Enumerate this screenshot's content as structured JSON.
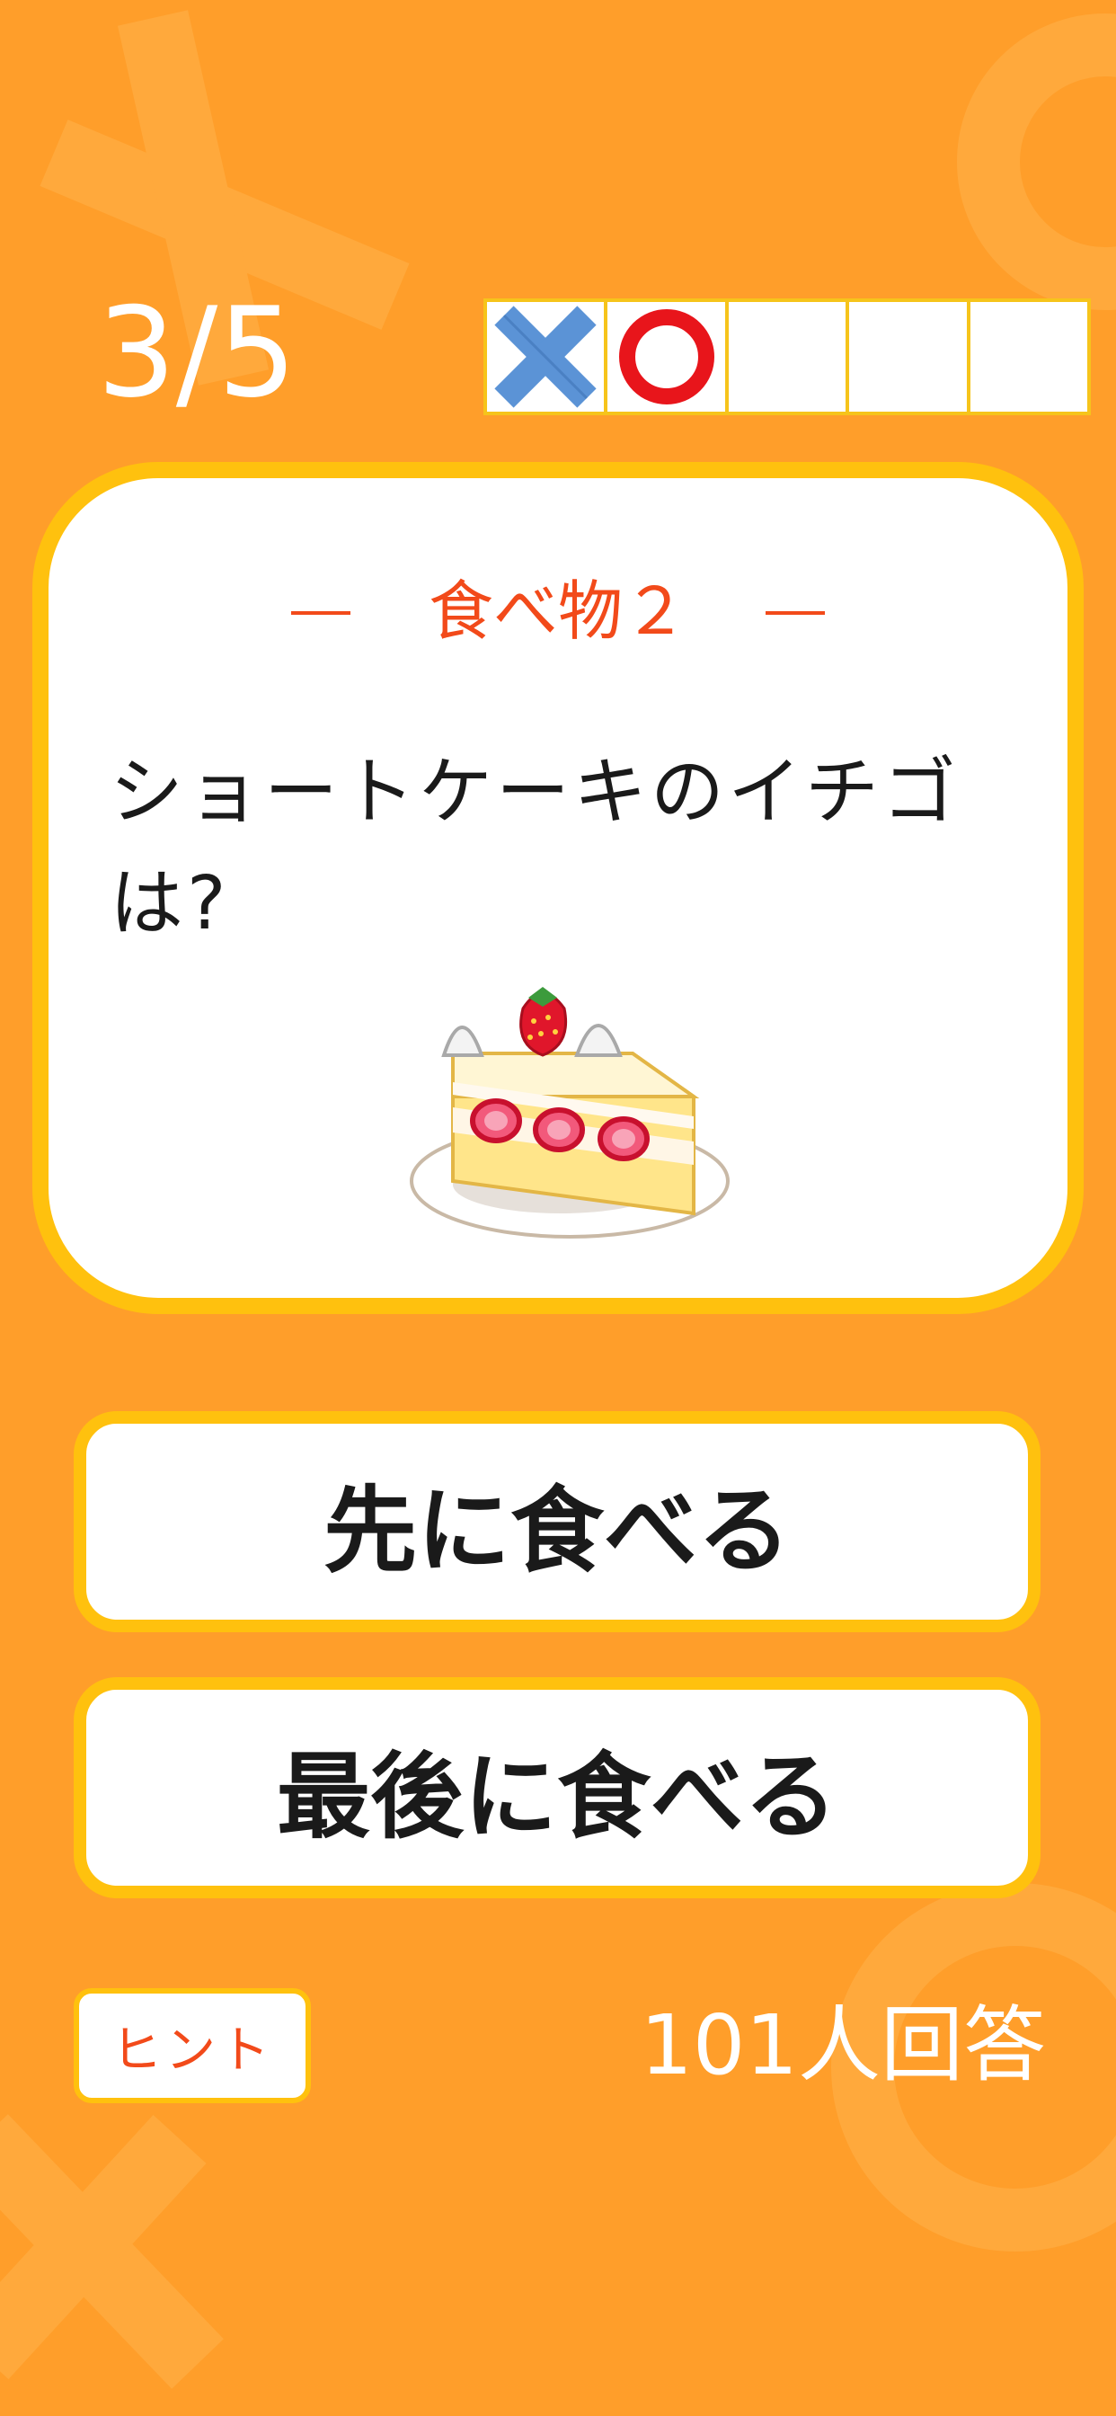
{
  "progress": {
    "label": "3/5",
    "current": 3,
    "total": 5
  },
  "results": [
    {
      "icon": "cross-mark-icon"
    },
    {
      "icon": "circle-mark-icon"
    },
    {
      "icon": "empty-slot"
    },
    {
      "icon": "empty-slot"
    },
    {
      "icon": "empty-slot"
    }
  ],
  "question": {
    "category": "食べ物２",
    "line1": "ショートケーキのイチゴ",
    "line2": "は?",
    "image": "strawberry-shortcake-illustration"
  },
  "answers": [
    {
      "label": "先に食べる"
    },
    {
      "label": "最後に食べる"
    }
  ],
  "hint": {
    "label": "ヒント"
  },
  "stats": {
    "answer_count": "101人回答"
  },
  "colors": {
    "background": "#FF9E2A",
    "accent_yellow": "#FFC10E",
    "category_red": "#F24A1A",
    "cross_blue": "#5B93D6",
    "circle_red": "#E8151B"
  }
}
